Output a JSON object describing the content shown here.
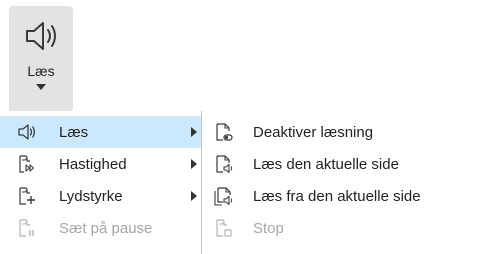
{
  "ribbon": {
    "read_label": "Læs"
  },
  "menu": {
    "items": [
      {
        "label": "Læs",
        "icon": "speaker-icon",
        "has_submenu": true,
        "selected": true,
        "enabled": true
      },
      {
        "label": "Hastighed",
        "icon": "speed-icon",
        "has_submenu": true,
        "selected": false,
        "enabled": true
      },
      {
        "label": "Lydstyrke",
        "icon": "volume-icon",
        "has_submenu": true,
        "selected": false,
        "enabled": true
      },
      {
        "label": "Sæt på pause",
        "icon": "pause-icon",
        "has_submenu": false,
        "selected": false,
        "enabled": false
      }
    ]
  },
  "submenu": {
    "items": [
      {
        "label": "Deaktiver læsning",
        "icon": "disable-reading-icon",
        "enabled": true
      },
      {
        "label": "Læs den aktuelle side",
        "icon": "read-page-icon",
        "enabled": true
      },
      {
        "label": "Læs fra den aktuelle side",
        "icon": "read-from-page-icon",
        "enabled": true
      },
      {
        "label": "Stop",
        "icon": "stop-icon",
        "enabled": false
      }
    ]
  },
  "colors": {
    "selection": "#cce8ff",
    "ribbon_button_bg": "#e3e3e3",
    "disabled_text": "#a6a6a6",
    "icon_stroke": "#3a3a3a"
  }
}
